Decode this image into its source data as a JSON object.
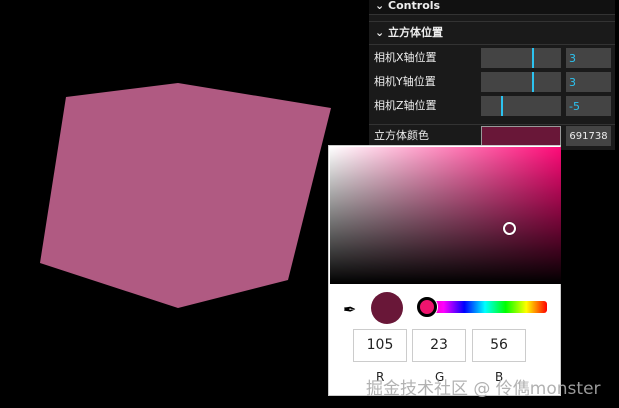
{
  "scene": {
    "cube_color": "#b05a82"
  },
  "controls": {
    "title": "Controls",
    "folder": "立方体位置",
    "rows": [
      {
        "label": "相机X轴位置",
        "value": "3",
        "fraction": 0.65
      },
      {
        "label": "相机Y轴位置",
        "value": "3",
        "fraction": 0.65
      },
      {
        "label": "相机Z轴位置",
        "value": "-5",
        "fraction": 0.25
      }
    ],
    "color_label": "立方体颜色",
    "color_hex": "691738"
  },
  "picker": {
    "r": "105",
    "g": "23",
    "b": "56",
    "r_label": "R",
    "g_label": "G",
    "b_label": "B"
  },
  "watermark": "掘金技术社区 @ 伶儁monster"
}
